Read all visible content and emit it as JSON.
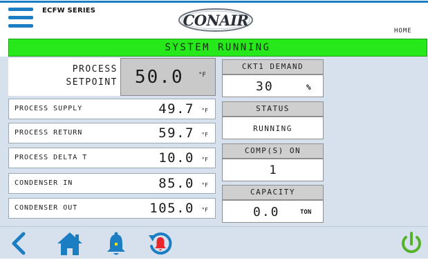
{
  "header": {
    "series": "ECFW SERIES",
    "logo_text": "CONAIR",
    "home_label": "HOME",
    "icons": {
      "menu": "hamburger-menu-icon"
    }
  },
  "status": {
    "text": "SYSTEM RUNNING",
    "color": "#27e81a"
  },
  "setpoint": {
    "label_line1": "PROCESS",
    "label_line2": "SETPOINT",
    "value": "50.0",
    "unit": "°F"
  },
  "readings": [
    {
      "label": "PROCESS SUPPLY",
      "value": "49.7",
      "unit": "°F"
    },
    {
      "label": "PROCESS RETURN",
      "value": "59.7",
      "unit": "°F"
    },
    {
      "label": "PROCESS DELTA T",
      "value": "10.0",
      "unit": "°F"
    },
    {
      "label": "CONDENSER IN",
      "value": "85.0",
      "unit": "°F"
    },
    {
      "label": "CONDENSER OUT",
      "value": "105.0",
      "unit": "°F"
    }
  ],
  "tiles": {
    "ckt1_demand": {
      "title": "CKT1 DEMAND",
      "value": "30",
      "unit": "%"
    },
    "status": {
      "title": "STATUS",
      "value": "RUNNING"
    },
    "comps_on": {
      "title": "COMP(S) ON",
      "value": "1"
    },
    "capacity": {
      "title": "CAPACITY",
      "value": "0.0",
      "unit": "TON"
    }
  },
  "footer": {
    "icons": [
      "back-arrow-icon",
      "home-icon",
      "bell-icon",
      "alarm-history-icon",
      "power-icon"
    ],
    "accent": "#1b7ec2",
    "alarm_color": "#e8262b",
    "power_color": "#55b22a"
  }
}
